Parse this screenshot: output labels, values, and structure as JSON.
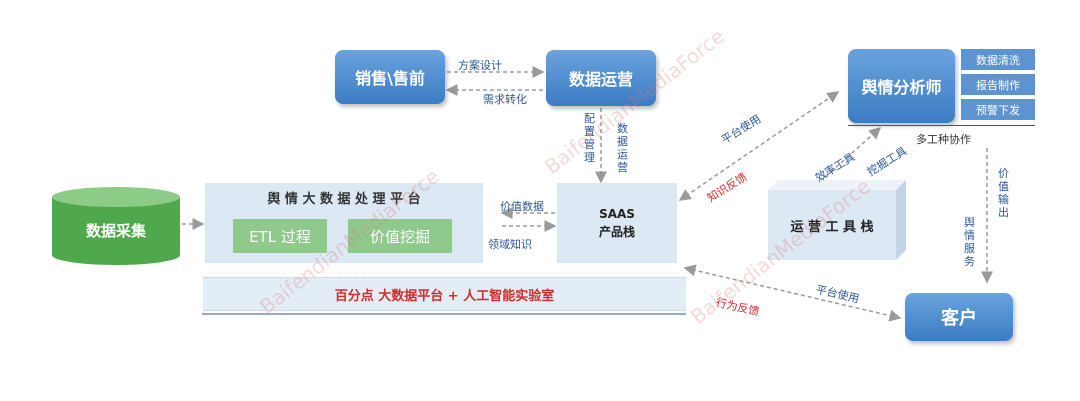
{
  "nodes": {
    "sales": "销售\\售前",
    "data_ops": "数据运营",
    "analyst": "舆情分析师",
    "data_collect": "数据采集",
    "platform_title": "舆 情 大 数 据 处 理 平 台",
    "etl": "ETL 过程",
    "value_mining": "价值挖掘",
    "saas_line1": "SAAS",
    "saas_line2": "产品栈",
    "ops_tools": "运 营 工 具 栈",
    "customer": "客户",
    "bottom_bar": "百分点 大数据平台 +  人工智能实验室"
  },
  "analyst_tags": [
    "数据清洗",
    "报告制作",
    "预警下发"
  ],
  "edge_labels": {
    "plan_design": "方案设计",
    "demand_transform": "需求转化",
    "config_mgmt": "配置管理",
    "data_ops_v": "数据运营",
    "value_data": "价值数据",
    "domain_knowledge": "领域知识",
    "platform_use_top": "平台使用",
    "knowledge_feedback": "知识反馈",
    "efficiency_tools": "效率工具",
    "mining_tools": "挖掘工具",
    "multi_role": "多工种协作",
    "value_output": "价值输出",
    "sentiment_service": "舆情服务",
    "platform_use_bottom": "平台使用",
    "behavior_feedback": "行为反馈"
  },
  "watermark": "BaifendianMediaForce",
  "colors": {
    "blue": "#3c7cc4",
    "green": "#6cb668",
    "panel": "#dce8f3",
    "red": "#d12b2b",
    "arrow": "#9a9a9a"
  }
}
